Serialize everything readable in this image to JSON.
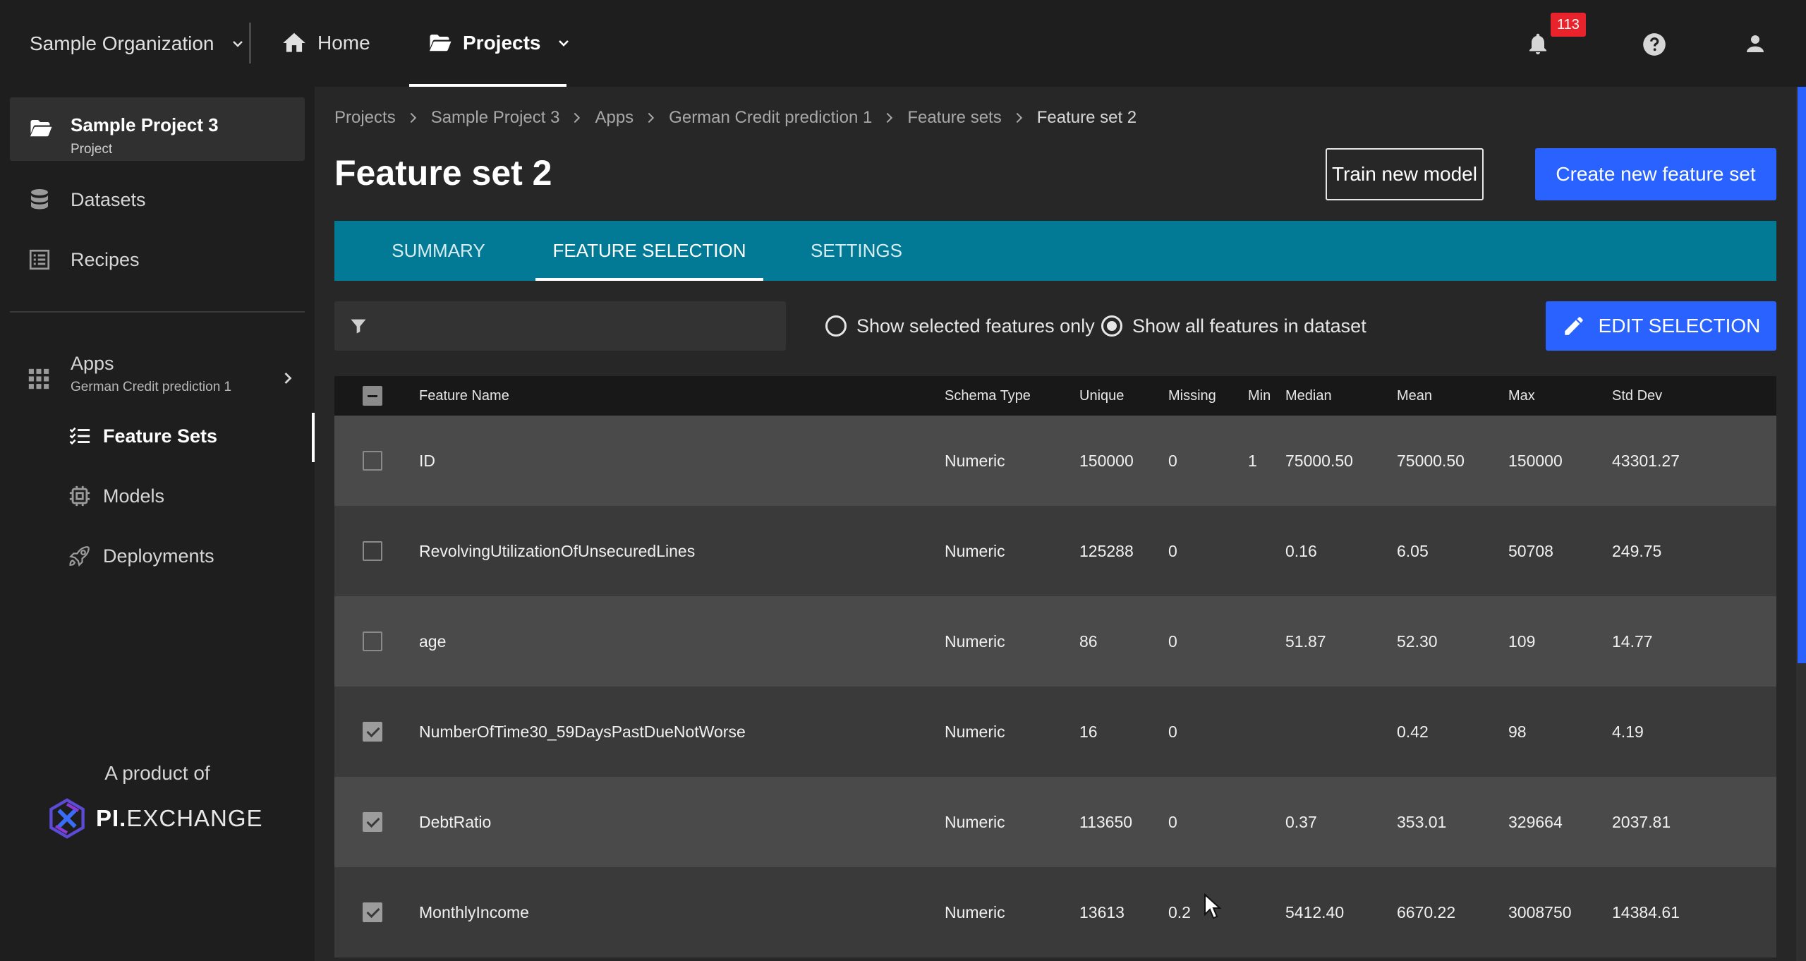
{
  "topbar": {
    "org_name": "Sample Organization",
    "home_label": "Home",
    "projects_label": "Projects",
    "notification_count": "113"
  },
  "sidebar": {
    "project_name": "Sample Project 3",
    "project_sub": "Project",
    "datasets_label": "Datasets",
    "recipes_label": "Recipes",
    "apps_label": "Apps",
    "apps_sub": "German Credit prediction 1",
    "feature_sets_label": "Feature Sets",
    "models_label": "Models",
    "deployments_label": "Deployments",
    "product_of": "A product of",
    "logo_pi": "PI.",
    "logo_exchange": "EXCHANGE"
  },
  "breadcrumb": [
    "Projects",
    "Sample Project 3",
    "Apps",
    "German Credit prediction 1",
    "Feature sets",
    "Feature set 2"
  ],
  "page": {
    "title": "Feature set 2",
    "train_label": "Train new model",
    "create_label": "Create new feature set"
  },
  "tabs": [
    {
      "label": "SUMMARY"
    },
    {
      "label": "FEATURE SELECTION"
    },
    {
      "label": "SETTINGS"
    }
  ],
  "filters": {
    "selected_only": "Show selected features only",
    "show_all": "Show all features in dataset",
    "edit_label": "EDIT SELECTION"
  },
  "table": {
    "headers": [
      "Feature Name",
      "Schema Type",
      "Unique",
      "Missing",
      "Min",
      "Median",
      "Mean",
      "Max",
      "Std Dev"
    ],
    "rows": [
      {
        "checked": false,
        "name": "ID",
        "type": "Numeric",
        "unique": "150000",
        "missing": "0",
        "min": "1",
        "median": "75000.50",
        "mean": "75000.50",
        "max": "150000",
        "std": "43301.27"
      },
      {
        "checked": false,
        "name": "RevolvingUtilizationOfUnsecuredLines",
        "type": "Numeric",
        "unique": "125288",
        "missing": "0",
        "min": "",
        "median": "0.16",
        "mean": "6.05",
        "max": "50708",
        "std": "249.75"
      },
      {
        "checked": false,
        "name": "age",
        "type": "Numeric",
        "unique": "86",
        "missing": "0",
        "min": "",
        "median": "51.87",
        "mean": "52.30",
        "max": "109",
        "std": "14.77"
      },
      {
        "checked": true,
        "name": "NumberOfTime30_59DaysPastDueNotWorse",
        "type": "Numeric",
        "unique": "16",
        "missing": "0",
        "min": "",
        "median": "",
        "mean": "0.42",
        "max": "98",
        "std": "4.19"
      },
      {
        "checked": true,
        "name": "DebtRatio",
        "type": "Numeric",
        "unique": "113650",
        "missing": "0",
        "min": "",
        "median": "0.37",
        "mean": "353.01",
        "max": "329664",
        "std": "2037.81"
      },
      {
        "checked": true,
        "name": "MonthlyIncome",
        "type": "Numeric",
        "unique": "13613",
        "missing": "0.2",
        "min": "",
        "median": "5412.40",
        "mean": "6670.22",
        "max": "3008750",
        "std": "14384.61"
      }
    ]
  },
  "colors": {
    "accent": "#2962ff",
    "tab_bar": "#027a96",
    "badge": "#e8232b"
  }
}
